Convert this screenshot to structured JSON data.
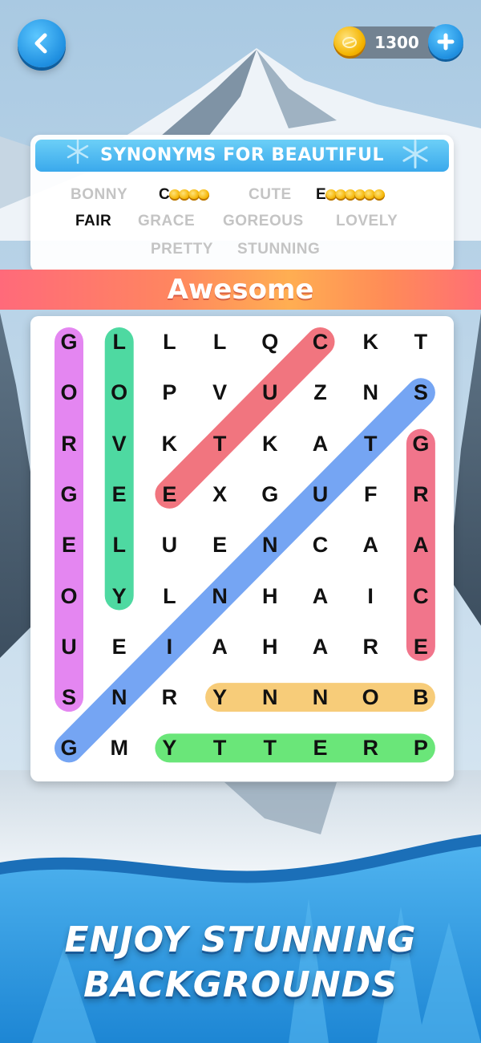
{
  "header": {
    "coins": "1300"
  },
  "category": "SYNONYMS FOR BEAUTIFUL",
  "words": [
    {
      "text": "BONNY",
      "state": "found"
    },
    {
      "text": "C",
      "state": "hint",
      "hint_coins": 4
    },
    {
      "text": "CUTE",
      "state": "found"
    },
    {
      "text": "E",
      "state": "hint",
      "hint_coins": 6
    },
    {
      "text": "FAIR",
      "state": "active"
    },
    {
      "text": "GRACE",
      "state": "found"
    },
    {
      "text": "GOREOUS",
      "state": "found"
    },
    {
      "text": "LOVELY",
      "state": "found"
    },
    {
      "text": "PRETTY",
      "state": "found"
    },
    {
      "text": "STUNNING",
      "state": "found"
    }
  ],
  "banner": "Awesome",
  "grid": [
    [
      "G",
      "L",
      "L",
      "L",
      "Q",
      "C",
      "K",
      "T"
    ],
    [
      "O",
      "O",
      "P",
      "V",
      "U",
      "Z",
      "N",
      "S"
    ],
    [
      "R",
      "V",
      "K",
      "T",
      "K",
      "A",
      "T",
      "G"
    ],
    [
      "G",
      "E",
      "E",
      "X",
      "G",
      "U",
      "F",
      "R"
    ],
    [
      "E",
      "L",
      "U",
      "E",
      "N",
      "C",
      "A",
      "A"
    ],
    [
      "O",
      "Y",
      "L",
      "N",
      "H",
      "A",
      "I",
      "C"
    ],
    [
      "U",
      "E",
      "I",
      "A",
      "H",
      "A",
      "R",
      "E"
    ],
    [
      "S",
      "N",
      "R",
      "Y",
      "N",
      "N",
      "O",
      "B"
    ],
    [
      "G",
      "M",
      "Y",
      "T",
      "T",
      "E",
      "R",
      "P"
    ]
  ],
  "highlights": [
    {
      "word": "GORGEOUS",
      "color": "#e27cf0",
      "from": [
        0,
        0
      ],
      "to": [
        7,
        0
      ]
    },
    {
      "word": "LOVELY",
      "color": "#3fd69a",
      "from": [
        0,
        1
      ],
      "to": [
        5,
        1
      ]
    },
    {
      "word": "CUTE",
      "color": "#f06a75",
      "from": [
        0,
        5
      ],
      "to": [
        3,
        2
      ]
    },
    {
      "word": "STUNNING",
      "color": "#6a9ef2",
      "from": [
        1,
        7
      ],
      "to": [
        8,
        0
      ]
    },
    {
      "word": "GRACE",
      "color": "#f06a82",
      "from": [
        2,
        7
      ],
      "to": [
        6,
        7
      ]
    },
    {
      "word": "BONNY",
      "color": "#f7c86e",
      "from": [
        7,
        3
      ],
      "to": [
        7,
        7
      ]
    },
    {
      "word": "PRETTY",
      "color": "#5ee46e",
      "from": [
        8,
        2
      ],
      "to": [
        8,
        7
      ]
    }
  ],
  "footer": {
    "line1": "ENJOY STUNNING",
    "line2": "BACKGROUNDS"
  },
  "colors": {
    "accent_blue": "#2a9be8",
    "banner_orange": "#ff8a5a",
    "coin_gold": "#f4b400"
  }
}
